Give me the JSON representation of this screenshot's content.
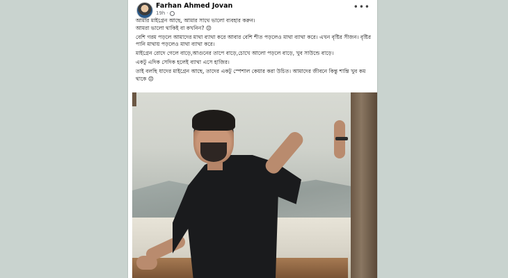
{
  "post": {
    "author": "Farhan Ahmed Jovan",
    "time": "19h",
    "more_icon": "more-horizontal-icon",
    "privacy_icon": "globe-icon",
    "paragraphs": [
      "আমার মাইগ্রেন আছে, আমার সাথে ভালো ব্যবহার করুন।",
      "আমরা ভালো থাকিই বা কখনিন? 😔",
      "বেশি গরম পড়লে আমাদের মাথা ব্যাথা করে আবার বেশি শীত পড়লেও মাথা ব্যাথা করে। এখন বৃষ্টির সীজন। বৃষ্টির পানি মাথায় পড়লেও মাথা ব্যাথা করে।",
      "মাইগ্রেন রোদে গেলে বাড়ে,আগুনের তাপে বাড়ে,চোখে আলো পড়লে বাড়ে, খুব সাউন্ডে বাড়ে।",
      "একটু এদিক সেদিক হলেই ব্যাথা এসে হাজির।",
      "তাই বলছি যাদের মাইগ্রেন আছে, তাদের একটু স্পেশাল কেয়ার করা উচিত। আমাদের জীবনে কিন্তু শান্তি খুব কম থাকে 😔"
    ]
  }
}
